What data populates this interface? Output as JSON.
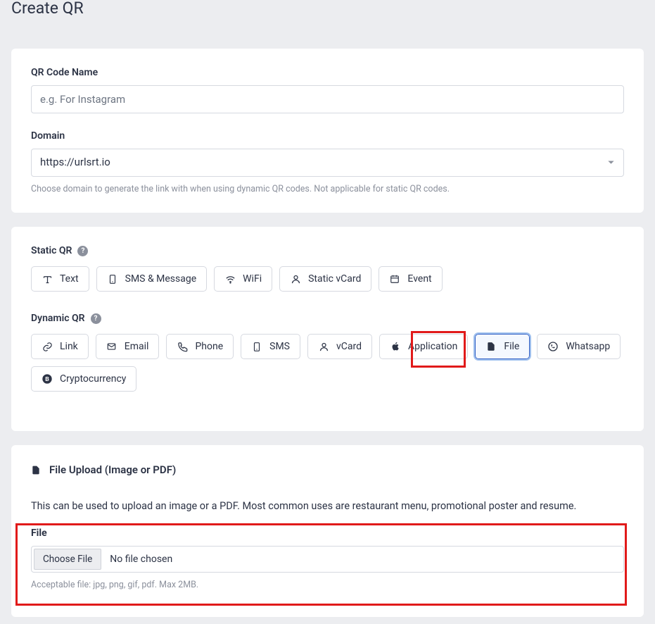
{
  "pageTitle": "Create QR",
  "form": {
    "qrName": {
      "label": "QR Code Name",
      "placeholder": "e.g. For Instagram",
      "value": ""
    },
    "domain": {
      "label": "Domain",
      "selected": "https://urlsrt.io",
      "help": "Choose domain to generate the link with when using dynamic QR codes. Not applicable for static QR codes."
    }
  },
  "sections": {
    "staticLabel": "Static QR",
    "dynamicLabel": "Dynamic QR"
  },
  "staticTypes": {
    "text": "Text",
    "sms": "SMS & Message",
    "wifi": "WiFi",
    "vcard": "Static vCard",
    "event": "Event"
  },
  "dynamicTypes": {
    "link": "Link",
    "email": "Email",
    "phone": "Phone",
    "sms": "SMS",
    "vcard": "vCard",
    "application": "Application",
    "file": "File",
    "whatsapp": "Whatsapp",
    "crypto": "Cryptocurrency"
  },
  "fileUpload": {
    "heading": "File Upload (Image or PDF)",
    "description": "This can be used to upload an image or a PDF. Most common uses are restaurant menu, promotional poster and resume.",
    "label": "File",
    "button": "Choose File",
    "status": "No file chosen",
    "help": "Acceptable file: jpg, png, gif, pdf. Max 2MB."
  },
  "icons": {
    "help": "?"
  }
}
